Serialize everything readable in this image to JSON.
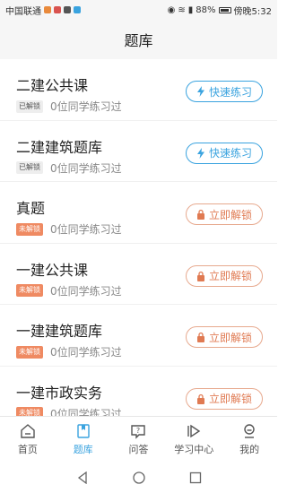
{
  "statusbar": {
    "carrier": "中国联通",
    "battery_percent": "88%",
    "time": "傍晚5:32"
  },
  "header": {
    "title": "题库"
  },
  "rows": [
    {
      "title": "二建公共课",
      "badge": "已解锁",
      "count_text": "0位同学练习过",
      "action": "快速练习",
      "locked": false
    },
    {
      "title": "二建建筑题库",
      "badge": "已解锁",
      "count_text": "0位同学练习过",
      "action": "快速练习",
      "locked": false
    },
    {
      "title": "真题",
      "badge": "未解锁",
      "count_text": "0位同学练习过",
      "action": "立即解锁",
      "locked": true
    },
    {
      "title": "一建公共课",
      "badge": "未解锁",
      "count_text": "0位同学练习过",
      "action": "立即解锁",
      "locked": true
    },
    {
      "title": "一建建筑题库",
      "badge": "未解锁",
      "count_text": "0位同学练习过",
      "action": "立即解锁",
      "locked": true
    },
    {
      "title": "一建市政实务",
      "badge": "未解锁",
      "count_text": "0位同学练习过",
      "action": "立即解锁",
      "locked": true
    }
  ],
  "tabbar": {
    "tabs": [
      {
        "label": "首页",
        "icon": "home-icon",
        "active": false
      },
      {
        "label": "题库",
        "icon": "bookmark-book-icon",
        "active": true
      },
      {
        "label": "问答",
        "icon": "question-bubble-icon",
        "active": false
      },
      {
        "label": "学习中心",
        "icon": "play-icon",
        "active": false
      },
      {
        "label": "我的",
        "icon": "user-icon",
        "active": false
      }
    ]
  },
  "colors": {
    "accent": "#3aa3df",
    "unlock": "#e07a52",
    "locked_badge": "#ef8a62"
  }
}
